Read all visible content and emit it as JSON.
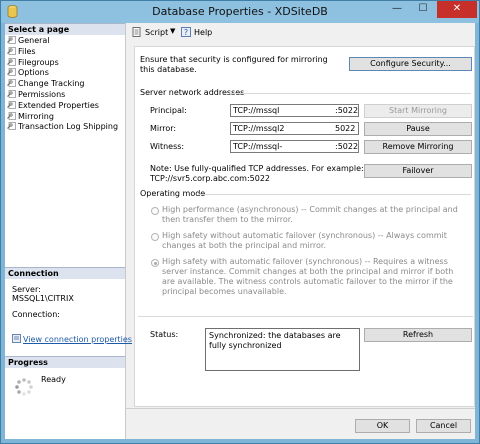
{
  "window": {
    "title": "Database Properties - XDSiteDB",
    "minimize_glyph": "—",
    "maximize_glyph": "☐",
    "close_glyph": "✕"
  },
  "left_pane": {
    "select_page_header": "Select a page",
    "pages": [
      {
        "label": "General",
        "icon": "wrench-page-icon"
      },
      {
        "label": "Files",
        "icon": "wrench-page-icon"
      },
      {
        "label": "Filegroups",
        "icon": "wrench-page-icon"
      },
      {
        "label": "Options",
        "icon": "wrench-page-icon"
      },
      {
        "label": "Change Tracking",
        "icon": "wrench-page-icon"
      },
      {
        "label": "Permissions",
        "icon": "wrench-page-icon"
      },
      {
        "label": "Extended Properties",
        "icon": "wrench-page-icon"
      },
      {
        "label": "Mirroring",
        "icon": "wrench-page-icon"
      },
      {
        "label": "Transaction Log Shipping",
        "icon": "wrench-page-icon"
      }
    ],
    "connection_header": "Connection",
    "server_label": "Server:",
    "server_value": "MSSQL1\\CITRIX",
    "connection_label": "Connection:",
    "view_connection_properties": "View connection properties",
    "progress_header": "Progress",
    "progress_status": "Ready"
  },
  "toolbar": {
    "script_label": "Script",
    "help_label": "Help"
  },
  "mirroring": {
    "security_note": "Ensure that security is configured for mirroring this database.",
    "configure_security_button": "Configure Security...",
    "server_network_addresses_label": "Server network addresses",
    "principal_label": "Principal:",
    "principal_value": "TCP://mssql",
    "principal_suffix": ":5022",
    "mirror_label": "Mirror:",
    "mirror_value": "TCP://mssql2",
    "mirror_suffix": "5022",
    "witness_label": "Witness:",
    "witness_value": "TCP://mssql-",
    "witness_suffix": ":5022",
    "start_mirroring_button": "Start Mirroring",
    "pause_button": "Pause",
    "remove_mirroring_button": "Remove Mirroring",
    "failover_button": "Failover",
    "fqdn_note_line1": "Note: Use fully-qualified TCP addresses. For example:",
    "fqdn_note_line2": "TCP://svr5.corp.abc.com:5022",
    "operating_mode_label": "Operating mode",
    "mode_high_performance": "High performance (asynchronous) -- Commit changes at the principal and then transfer them to the mirror.",
    "mode_high_safety_no_failover": "High safety without automatic failover (synchronous) -- Always commit changes at both the principal and mirror.",
    "mode_high_safety_failover": "High safety with automatic failover (synchronous) -- Requires a witness server instance. Commit changes at both the principal and mirror if both are available. The witness controls automatic failover to the mirror if the principal becomes unavailable.",
    "selected_mode": "mode_high_safety_failover",
    "status_label": "Status:",
    "status_value": "Synchronized: the databases are fully synchronized",
    "refresh_button": "Refresh"
  },
  "footer": {
    "ok_button": "OK",
    "cancel_button": "Cancel"
  }
}
